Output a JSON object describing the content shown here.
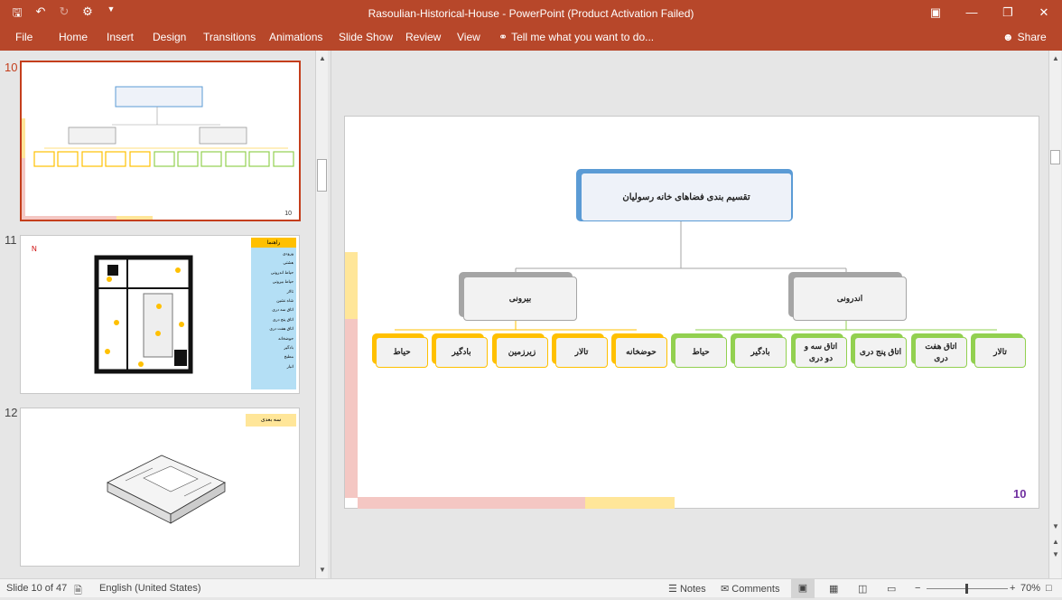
{
  "titlebar": {
    "title": "Rasoulian-Historical-House - PowerPoint (Product Activation Failed)",
    "qat": [
      "save-icon",
      "undo-icon",
      "redo-icon",
      "present-icon",
      "customize-icon"
    ]
  },
  "ribbon": {
    "file": "File",
    "tabs": [
      "Home",
      "Insert",
      "Design",
      "Transitions",
      "Animations",
      "Slide Show",
      "Review",
      "View"
    ],
    "tell_me": "Tell me what you want to do...",
    "share": "Share"
  },
  "thumbnails": [
    {
      "number": "10",
      "selected": true
    },
    {
      "number": "11",
      "selected": false
    },
    {
      "number": "12",
      "selected": false
    }
  ],
  "slide": {
    "title": "تقسیم بندی فضاهای خانه رسولیان",
    "left_branch": "بیرونی",
    "right_branch": "اندرونی",
    "left_items": [
      "حیاط",
      "بادگیر",
      "زیرزمین",
      "تالار",
      "حوضخانه"
    ],
    "right_items": [
      "حیاط",
      "بادگیر",
      "اتاق سه و دو دری",
      "اتاق پنج دری",
      "اتاق هفت دری",
      "تالار"
    ],
    "number": "10",
    "colors": {
      "title_border": "#5b9bd5",
      "branch_border": "#a5a5a5",
      "left_border": "#ffc000",
      "right_border": "#92d050",
      "number": "#7030a0"
    }
  },
  "thumb11": {
    "legend_title": "راهنما",
    "legend_items": [
      "ورودی",
      "هشتی",
      "حیاط اندرونی",
      "حیاط بیرونی",
      "تالار",
      "شاه نشین",
      "اتاق سه دری",
      "اتاق پنج دری",
      "اتاق هفت دری",
      "حوضخانه",
      "بادگیر",
      "مطبخ",
      "انبار"
    ],
    "north": "N"
  },
  "thumb12": {
    "label": "سه بعدی"
  },
  "status": {
    "slide": "Slide 10 of 47",
    "language": "English (United States)",
    "notes": "Notes",
    "comments": "Comments",
    "zoom": "70%"
  }
}
